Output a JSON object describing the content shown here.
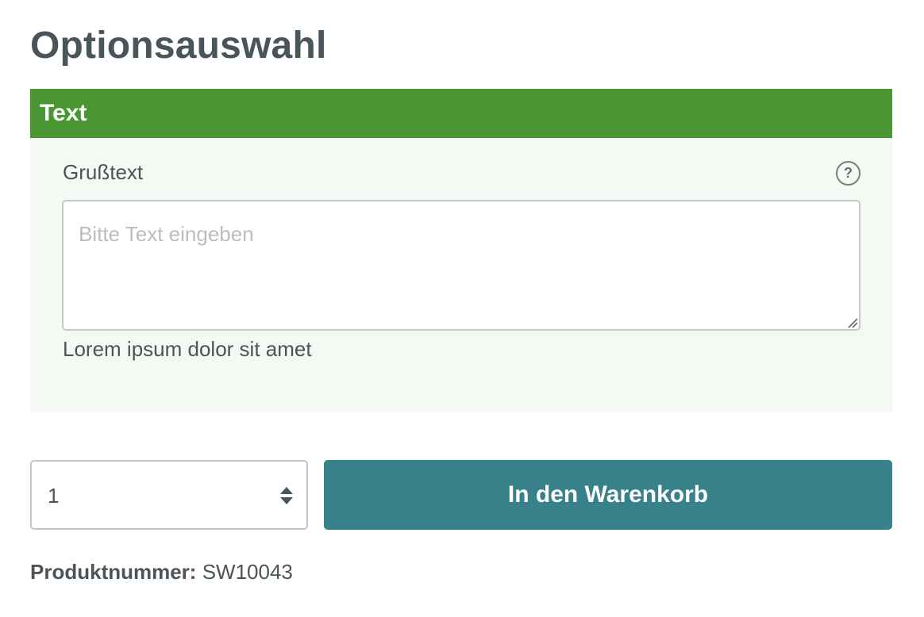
{
  "page_title": "Optionsauswahl",
  "option_group": {
    "header": "Text",
    "field": {
      "label": "Grußtext",
      "help_icon": "question-circle-icon",
      "placeholder": "Bitte Text eingeben",
      "value": "",
      "helper_text": "Lorem ipsum dolor sit amet"
    }
  },
  "purchase": {
    "quantity": "1",
    "quantity_icon": "sort-arrows-icon",
    "add_to_cart_label": "In den Warenkorb"
  },
  "product_number": {
    "label": "Produktnummer:",
    "value": "SW10043"
  },
  "colors": {
    "header_green": "#4a9632",
    "panel_background": "#f5f9f4",
    "button_teal": "#37818a",
    "text": "#4a545b"
  }
}
